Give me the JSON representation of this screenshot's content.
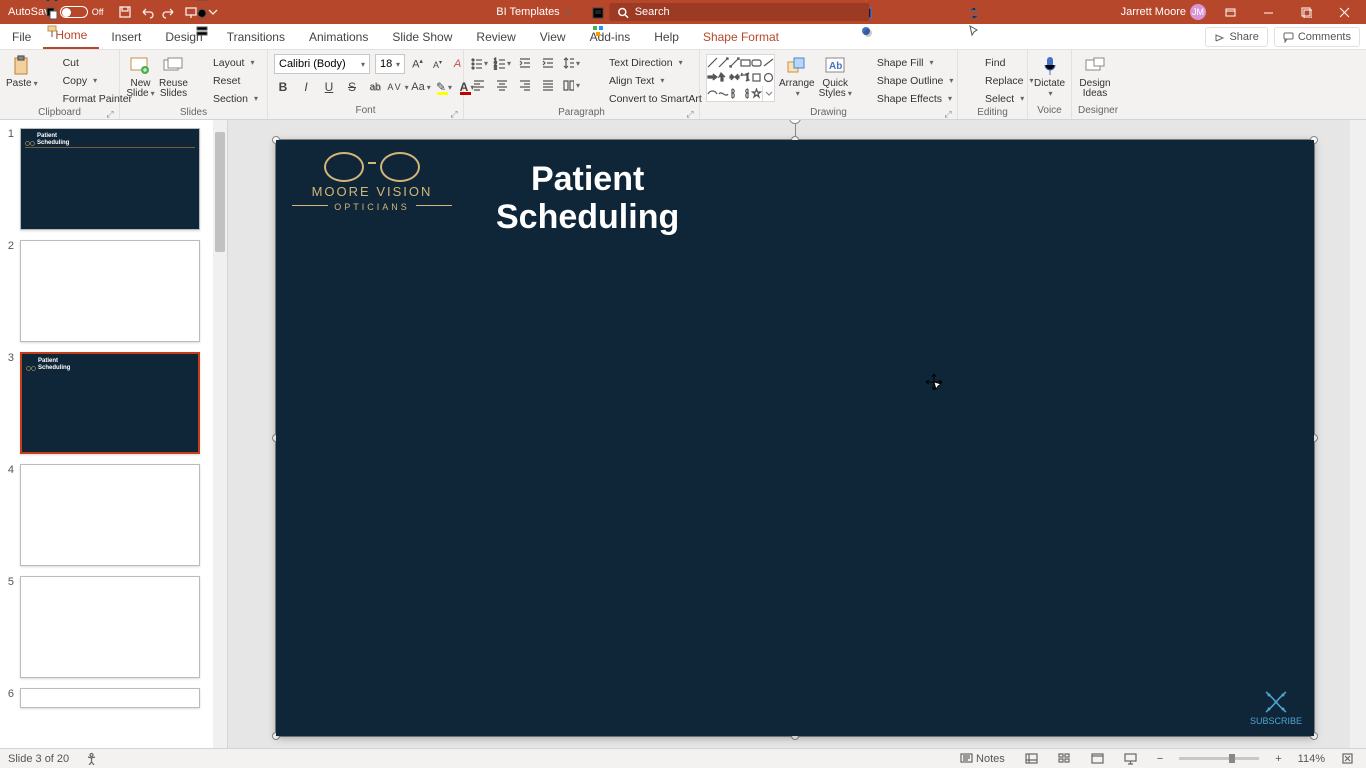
{
  "titlebar": {
    "autosave_label": "AutoSave",
    "autosave_state": "Off",
    "doc_title": "BI Templates",
    "search_placeholder": "Search",
    "user_name": "Jarrett Moore",
    "user_initials": "JM"
  },
  "tabs": {
    "file": "File",
    "home": "Home",
    "insert": "Insert",
    "design": "Design",
    "transitions": "Transitions",
    "animations": "Animations",
    "slideshow": "Slide Show",
    "review": "Review",
    "view": "View",
    "addins": "Add-ins",
    "help": "Help",
    "shape_format": "Shape Format",
    "share": "Share",
    "comments": "Comments"
  },
  "ribbon": {
    "clipboard": {
      "label": "Clipboard",
      "paste": "Paste",
      "cut": "Cut",
      "copy": "Copy",
      "format_painter": "Format Painter"
    },
    "slides": {
      "label": "Slides",
      "new_slide": "New\nSlide",
      "reuse_slides": "Reuse\nSlides",
      "layout": "Layout",
      "reset": "Reset",
      "section": "Section"
    },
    "font": {
      "label": "Font",
      "name": "Calibri (Body)",
      "size": "18"
    },
    "paragraph": {
      "label": "Paragraph",
      "text_direction": "Text Direction",
      "align_text": "Align Text",
      "convert_smartart": "Convert to SmartArt"
    },
    "drawing": {
      "label": "Drawing",
      "arrange": "Arrange",
      "quick_styles": "Quick\nStyles",
      "shape_fill": "Shape Fill",
      "shape_outline": "Shape Outline",
      "shape_effects": "Shape Effects"
    },
    "editing": {
      "label": "Editing",
      "find": "Find",
      "replace": "Replace",
      "select": "Select"
    },
    "voice": {
      "label": "Voice",
      "dictate": "Dictate"
    },
    "designer": {
      "label": "Designer",
      "ideas": "Design\nIdeas"
    }
  },
  "slide_content": {
    "brand_line1": "MOORE VISION",
    "brand_line2": "OPTICIANS",
    "title_line1": "Patient",
    "title_line2": "Scheduling",
    "subscribe": "SUBSCRIBE"
  },
  "thumbs": {
    "numbers": [
      "1",
      "2",
      "3",
      "4",
      "5",
      "6"
    ],
    "selected_index": 3
  },
  "statusbar": {
    "slide_info": "Slide 3 of 20",
    "notes": "Notes",
    "zoom": "114%"
  }
}
